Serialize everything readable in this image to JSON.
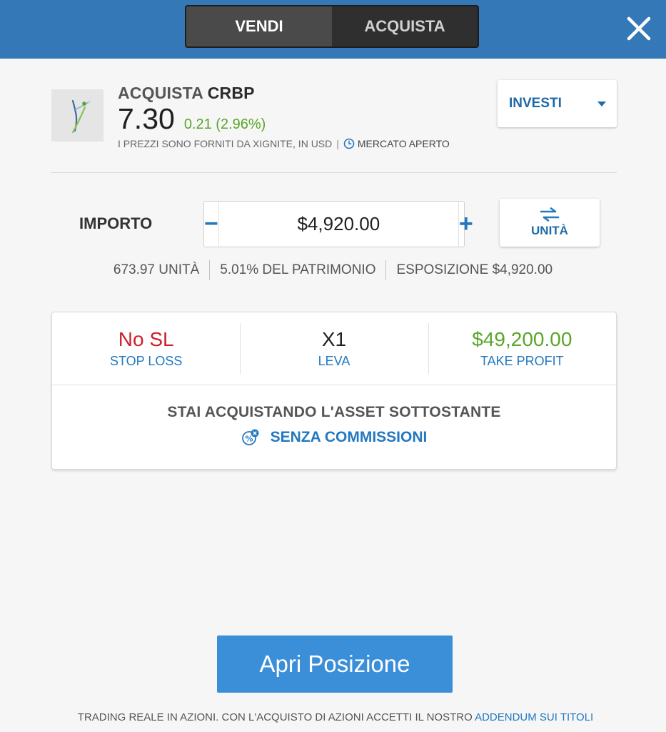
{
  "header": {
    "tabs": [
      {
        "label": "VENDI",
        "active": true
      },
      {
        "label": "ACQUISTA",
        "active": false
      }
    ],
    "close_icon": "close-icon"
  },
  "asset": {
    "action": "ACQUISTA",
    "symbol": "CRBP",
    "price": "7.30",
    "change": "0.21 (2.96%)",
    "price_source": "I PREZZI SONO FORNITI DA XIGNITE, IN USD",
    "separator": "|",
    "market_status": "MERCATO APERTO"
  },
  "order_type": {
    "label": "INVESTI"
  },
  "amount": {
    "label": "IMPORTO",
    "value": "$4,920.00",
    "minus": "−",
    "plus": "+"
  },
  "unit_toggle": {
    "label": "UNITÀ"
  },
  "stats": {
    "units": "673.97 UNITÀ",
    "equity": "5.01% DEL PATRIMONIO",
    "exposure": "ESPOSIZIONE $4,920.00"
  },
  "trade_settings": {
    "stop_loss": {
      "value": "No SL",
      "label": "STOP LOSS"
    },
    "leverage": {
      "value": "X1",
      "label": "LEVA"
    },
    "take_profit": {
      "value": "$49,200.00",
      "label": "TAKE PROFIT"
    }
  },
  "notice": {
    "line1": "STAI ACQUISTANDO L'ASSET SOTTOSTANTE",
    "line2": "SENZA COMMISSIONI"
  },
  "submit": {
    "label": "Apri Posizione"
  },
  "footer": {
    "text": "TRADING REALE IN AZIONI. CON L'ACQUISTO DI AZIONI ACCETTI IL NOSTRO ",
    "link": "ADDENDUM SUI TITOLI"
  },
  "colors": {
    "header_blue": "#3578b8",
    "accent_blue": "#2378c0",
    "positive_green": "#5aa52a",
    "negative_red": "#cf1f2a",
    "button_blue": "#3b8fd9"
  }
}
